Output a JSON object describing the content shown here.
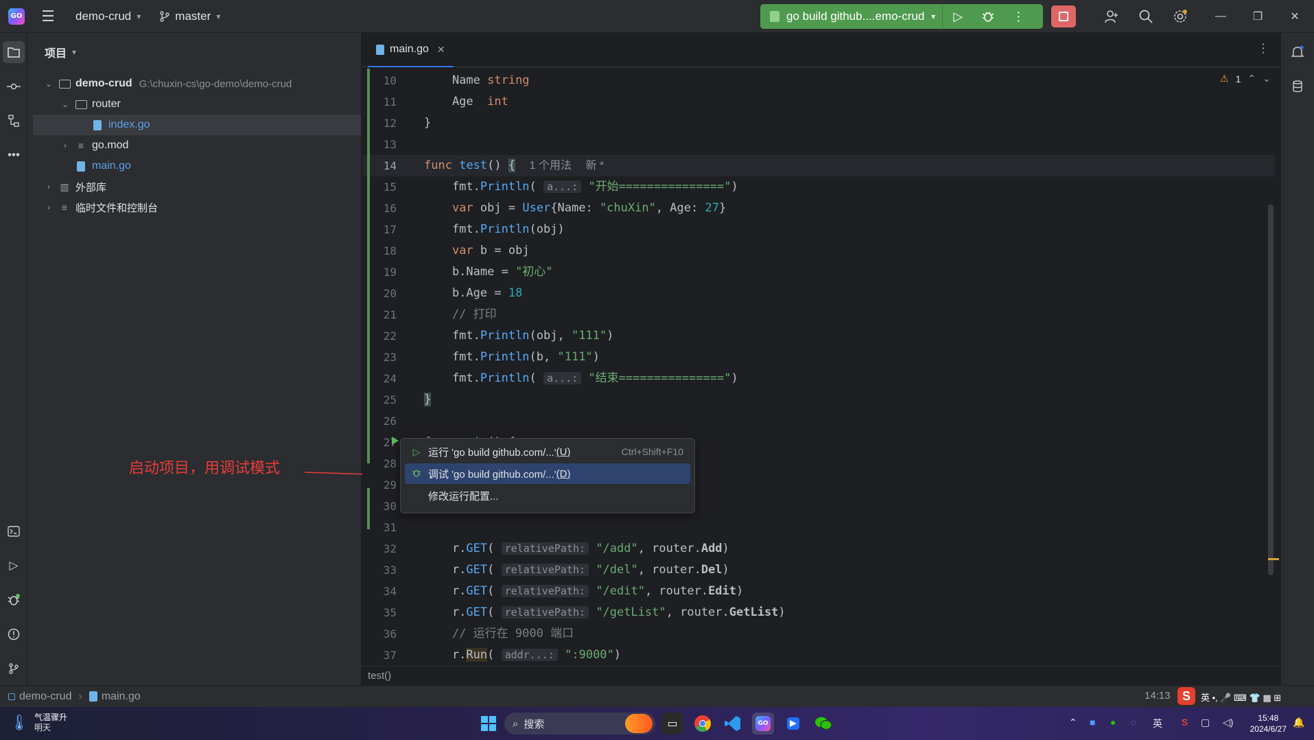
{
  "titlebar": {
    "logo_text": "GO",
    "project_name": "demo-crud",
    "branch": "master",
    "run_config": "go build github....emo-crud"
  },
  "project_panel": {
    "title": "项目",
    "tree": [
      {
        "label": "demo-crud",
        "path": "G:\\chuxin-cs\\go-demo\\demo-crud"
      },
      {
        "label": "router"
      },
      {
        "label": "index.go"
      },
      {
        "label": "go.mod"
      },
      {
        "label": "main.go"
      },
      {
        "label": "外部库"
      },
      {
        "label": "临时文件和控制台"
      }
    ]
  },
  "editor": {
    "tab": "main.go",
    "warnings": "1",
    "line_numbers": [
      "10",
      "11",
      "12",
      "13",
      "14",
      "15",
      "16",
      "17",
      "18",
      "19",
      "20",
      "21",
      "22",
      "23",
      "24",
      "25",
      "26",
      "27",
      "28",
      "29",
      "30",
      "31",
      "32",
      "33",
      "34",
      "35",
      "36",
      "37"
    ],
    "inline_hints": {
      "usages": "1 个用法",
      "new": "新 *",
      "a_param": "a...:",
      "relative_path": "relativePath:",
      "addr": "addr...:"
    },
    "breadcrumb": "test()"
  },
  "popup": {
    "items": [
      {
        "label": "运行 'go build github.com/...'",
        "mnemonic": "(U)",
        "shortcut": "Ctrl+Shift+F10"
      },
      {
        "label": "调试 'go build github.com/...'",
        "mnemonic": "(D)",
        "shortcut": ""
      },
      {
        "label": "修改运行配置...",
        "mnemonic": "",
        "shortcut": ""
      }
    ]
  },
  "annotation": {
    "text": "启动项目，用调试模式",
    "color": "#e83a3a"
  },
  "statusbar": {
    "project": "demo-crud",
    "file": "main.go",
    "position": "14:13"
  },
  "taskbar": {
    "weather_title": "气温骤升",
    "weather_sub": "明天",
    "search_placeholder": "搜索",
    "ime": "英",
    "time": "15:48",
    "date": "2024/6/27"
  },
  "colors": {
    "run_green": "#4e9a4e",
    "stop_red": "#e06666",
    "selection_blue": "#2e436e",
    "keyword": "#cf8e6d",
    "function": "#56a8f5",
    "string": "#6aab73",
    "number": "#2aacb8"
  }
}
